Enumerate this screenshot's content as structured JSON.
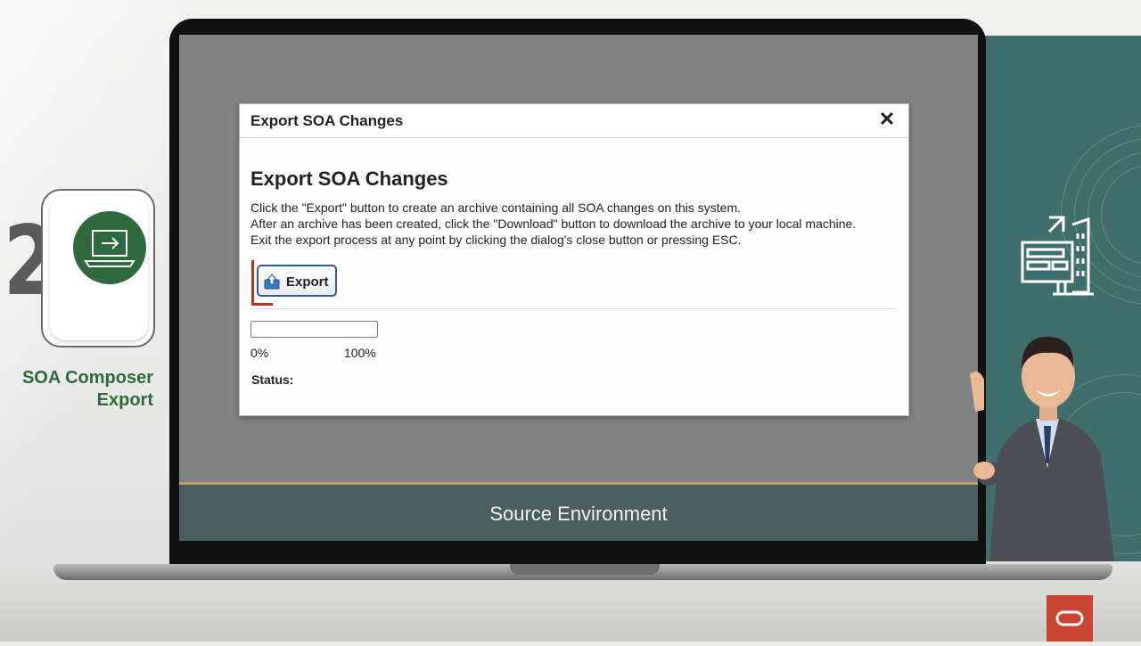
{
  "step": {
    "number": "2",
    "title_line1": "SOA Composer",
    "title_line2": "Export"
  },
  "screen": {
    "caption": "Source Environment"
  },
  "dialog": {
    "header_title": "Export SOA Changes",
    "close_glyph": "✕",
    "heading": "Export SOA Changes",
    "instructions": [
      "Click the \"Export\" button to create an archive containing all SOA changes on this system.",
      "After an archive has been created, click the \"Download\" button to download the archive to your local machine.",
      "Exit the export process at any point by clicking the dialog's close button or pressing ESC."
    ],
    "export_button_label": "Export",
    "export_button_icon": "upload-icon",
    "progress": {
      "value_percent": 0,
      "min_label": "0%",
      "max_label": "100%"
    },
    "status_label": "Status:"
  },
  "colors": {
    "brand_green": "#2e6a3b",
    "teal_panel": "#3f6e6c",
    "oracle_red": "#c74634",
    "focus_red": "#b5341f",
    "button_border": "#2e5b9b"
  },
  "icons": {
    "step_icon": "laptop-export-icon",
    "side_icon": "building-screen-icon",
    "logo": "oracle-logo-icon"
  }
}
